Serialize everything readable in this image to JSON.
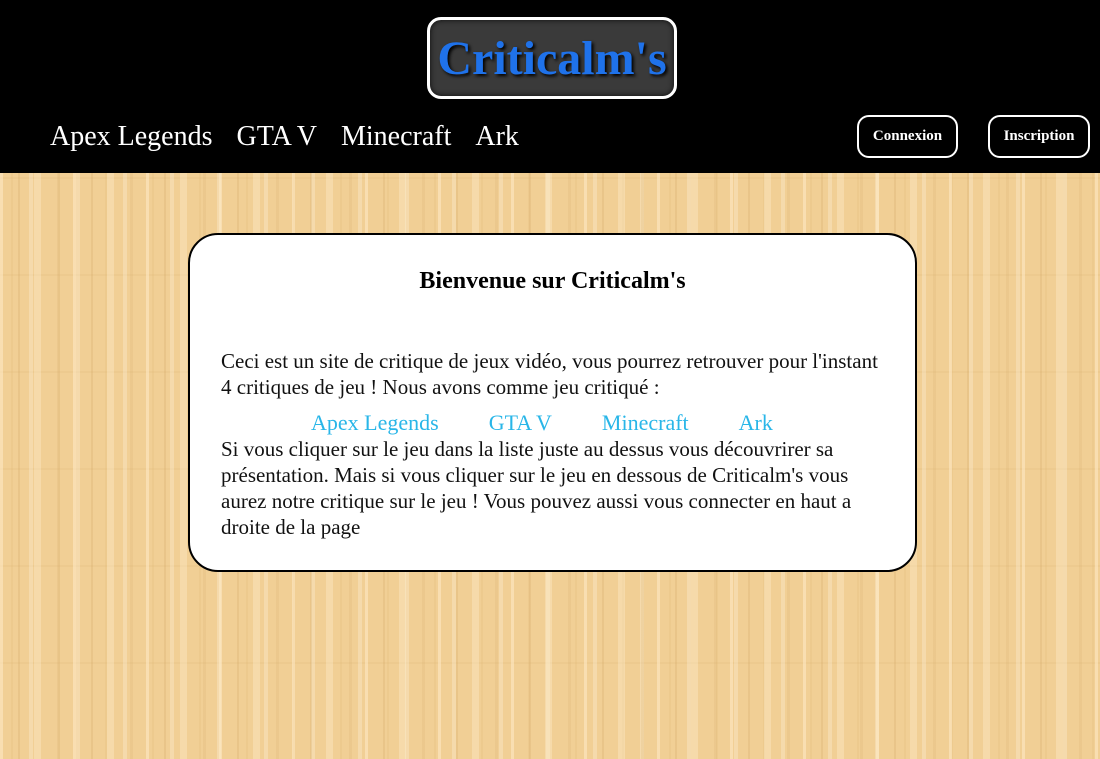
{
  "header": {
    "logo_text": "Criticalm's",
    "nav": [
      {
        "label": "Apex Legends"
      },
      {
        "label": "GTA V"
      },
      {
        "label": "Minecraft"
      },
      {
        "label": "Ark"
      }
    ],
    "login_label": "Connexion",
    "signup_label": "Inscription"
  },
  "card": {
    "title": "Bienvenue sur Criticalm's",
    "intro": "Ceci est un site de critique de jeux vidéo, vous pourrez retrouver pour l'instant 4 critiques de jeu ! Nous avons comme jeu critiqué :",
    "games": [
      {
        "label": "Apex Legends"
      },
      {
        "label": "GTA V"
      },
      {
        "label": "Minecraft"
      },
      {
        "label": "Ark"
      }
    ],
    "outro": "Si vous cliquer sur le jeu dans la liste juste au dessus vous découvrirer sa présentation. Mais si vous cliquer sur le jeu en dessous de Criticalm's vous aurez notre critique sur le jeu ! Vous pouvez aussi vous connecter en haut a droite de la page"
  },
  "colors": {
    "header_bg": "#000000",
    "logo_text": "#1f72ea",
    "game_link": "#29b6e8",
    "page_bg": "#f1cf95"
  }
}
